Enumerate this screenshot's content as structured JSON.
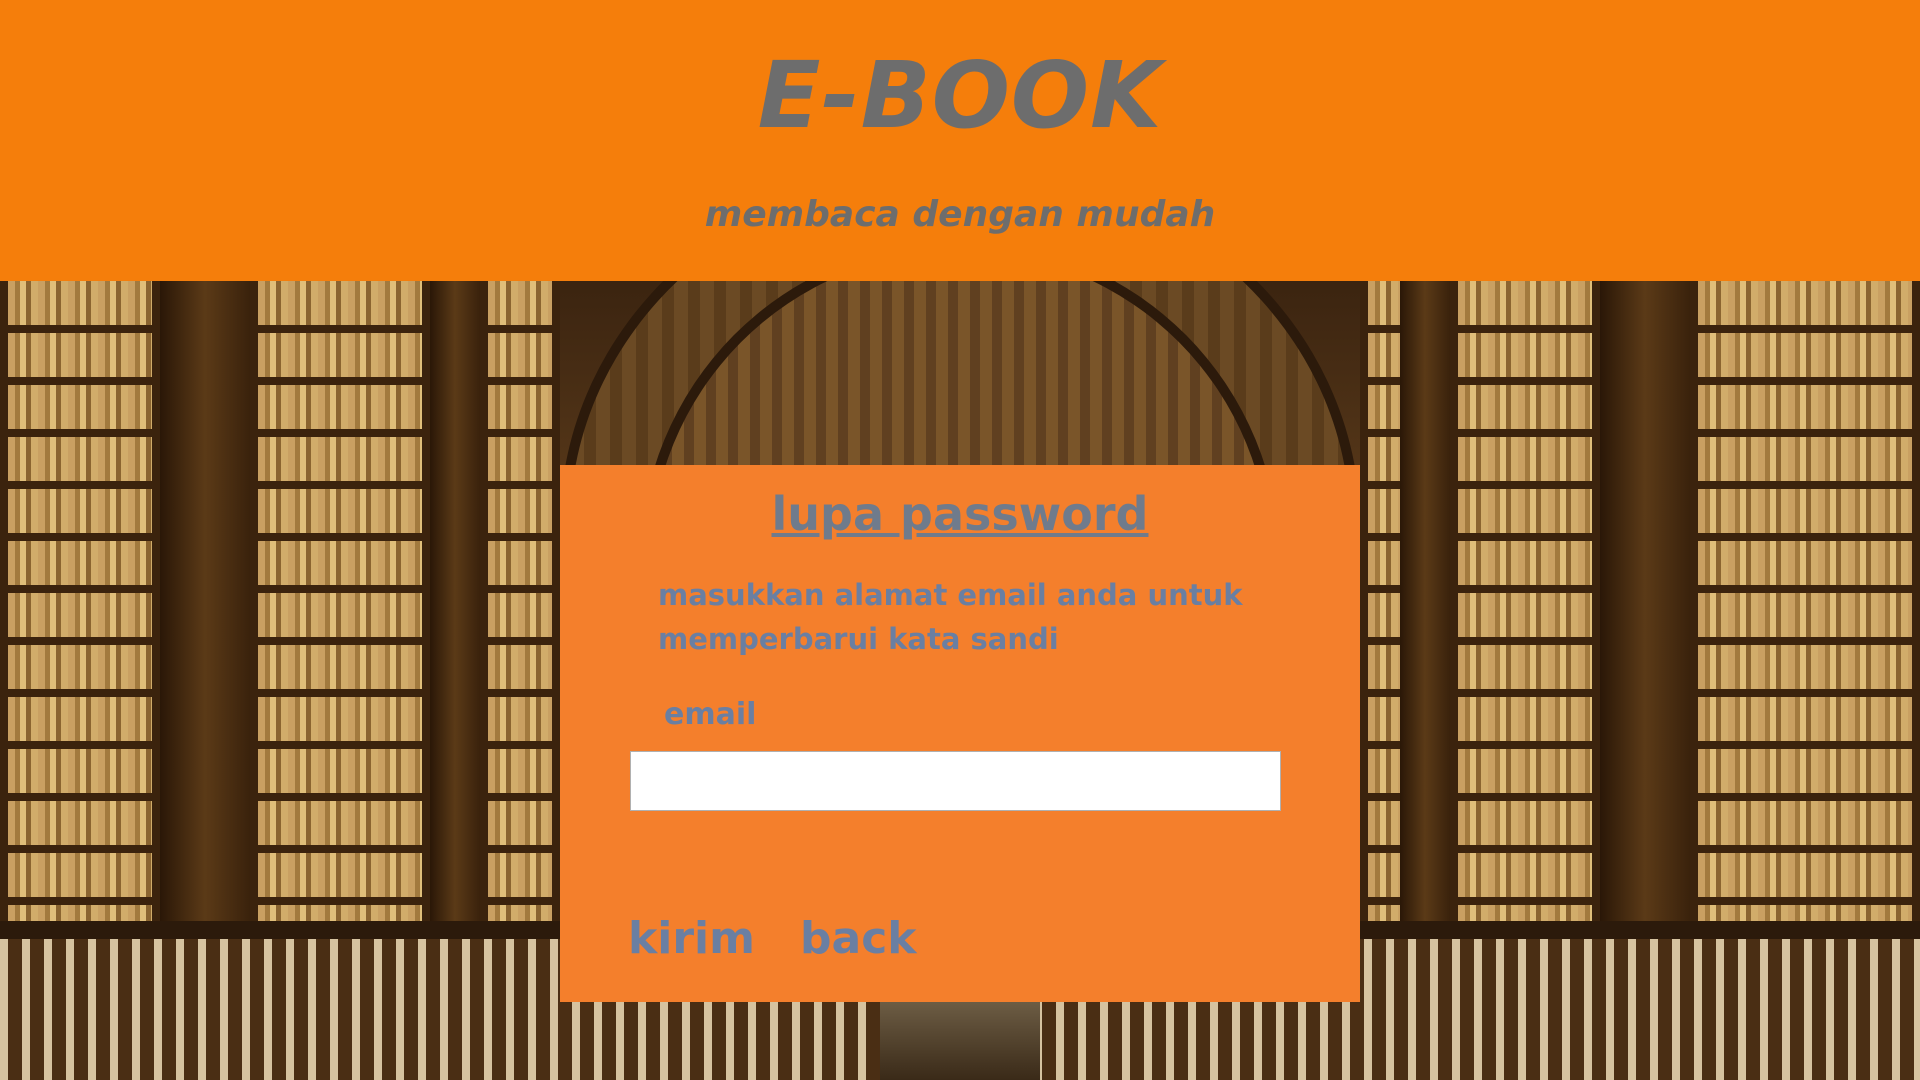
{
  "header": {
    "title": "E-BOOK",
    "subtitle": "membaca dengan mudah",
    "background_color": "#f57e0b",
    "text_color": "#6d6d6d"
  },
  "card": {
    "title": "lupa password",
    "instructions": "masukkan alamat email anda untuk memperbarui kata sandi",
    "email_label": "email",
    "email_value": "",
    "submit_label": "kirim",
    "back_label": "back",
    "background_color": "#f47f2c",
    "accent_text_color": "#6a7fa2"
  },
  "background": {
    "scene": "library-bookshelves-image"
  }
}
